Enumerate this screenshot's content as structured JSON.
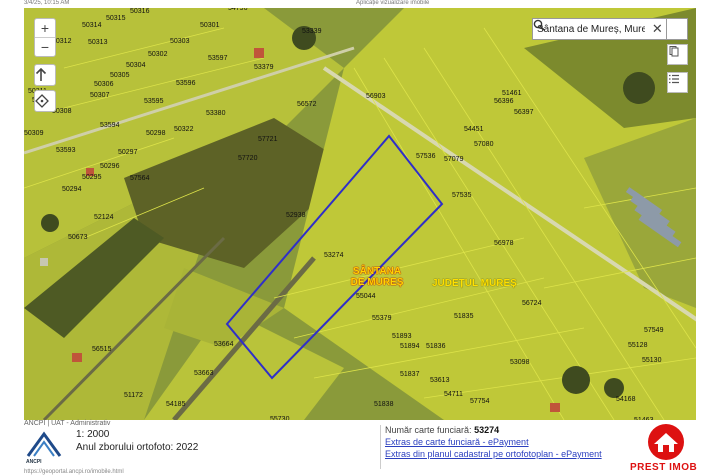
{
  "top_bar": {
    "left_text": "3/4/25, 10:15 AM",
    "center_text": "Aplicație vizualizare imobile"
  },
  "colors": {
    "parcel_fill": "#c6cf2e",
    "boundary": "#2f2fc8",
    "locality_label": "#ffd400",
    "link": "#2b3fbf",
    "brand_red": "#dd1111"
  },
  "map": {
    "zoom_in_label": "+",
    "zoom_out_label": "−",
    "north_icon": "arrow-up-icon",
    "locate_icon": "crosshair-icon",
    "search": {
      "value": "Sântana de Mureș, Mureș",
      "clear_icon": "close-icon",
      "search_icon": "search-icon"
    },
    "side_buttons": [
      "layers-icon",
      "list-icon"
    ],
    "locality_label": "SÂNTANA DE MUREȘ",
    "county_label": "JUDEȚUL MUREȘ",
    "selected_parcel": "53274",
    "parcels": [
      "50316",
      "50315",
      "50314",
      "50313",
      "50312",
      "50311",
      "50305",
      "50304",
      "50303",
      "50302",
      "50301",
      "50307",
      "50306",
      "50308",
      "50309",
      "50310",
      "53339",
      "53379",
      "53597",
      "53596",
      "53595",
      "53594",
      "53593",
      "53380",
      "54796",
      "56572",
      "56903",
      "57721",
      "57720",
      "57564",
      "50298",
      "50297",
      "50296",
      "50295",
      "50294",
      "50322",
      "52124",
      "50673",
      "52938",
      "53274",
      "55044",
      "51461",
      "56396",
      "56397",
      "54451",
      "57080",
      "57079",
      "57536",
      "57535",
      "56978",
      "56724",
      "55379",
      "51893",
      "51894",
      "51836",
      "51835",
      "51837",
      "53613",
      "53098",
      "54711",
      "51838",
      "57754",
      "55130",
      "55128",
      "57549",
      "51172",
      "54185",
      "56515",
      "53664",
      "53663",
      "55730",
      "51463",
      "54168"
    ]
  },
  "footer": {
    "attribution": "ANCPI | UAT - Administrativ",
    "logo_text": "ANCPI",
    "scale": "1: 2000",
    "flight_year": "Anul zborului ortofoto: 2022",
    "url": "https://geoportal.ancpi.ro/imobile.html",
    "cf_label": "Număr carte funciară:",
    "cf_number": "53274",
    "link1": "Extras de carte funciară - ePayment",
    "link2": "Extras din planul cadastral pe ortofotoplan - ePayment",
    "brand": "PREST IMOB"
  }
}
